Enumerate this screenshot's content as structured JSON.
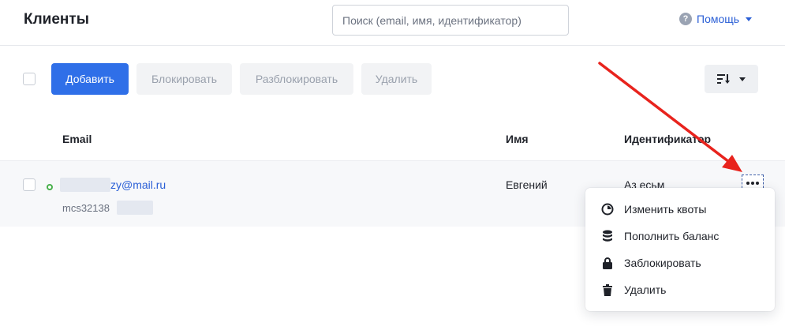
{
  "header": {
    "title": "Клиенты",
    "search_placeholder": "Поиск (email, имя, идентификатор)",
    "help_label": "Помощь"
  },
  "toolbar": {
    "add": "Добавить",
    "block": "Блокировать",
    "unblock": "Разблокировать",
    "delete": "Удалить"
  },
  "table": {
    "columns": {
      "email": "Email",
      "name": "Имя",
      "identifier": "Идентификатор"
    },
    "rows": [
      {
        "email": "zy@mail.ru",
        "subid": "mcs32138",
        "name": "Евгений",
        "identifier": "Аз есьм",
        "status": "active"
      }
    ]
  },
  "row_menu": {
    "items": [
      {
        "label": "Изменить квоты",
        "icon": "quota-icon"
      },
      {
        "label": "Пополнить баланс",
        "icon": "coins-icon"
      },
      {
        "label": "Заблокировать",
        "icon": "lock-icon"
      },
      {
        "label": "Удалить",
        "icon": "trash-icon"
      }
    ]
  },
  "colors": {
    "accent": "#2f6fe8",
    "link": "#2a5fd6",
    "status_online": "#49b04c",
    "annotation_arrow": "#e8231d"
  }
}
